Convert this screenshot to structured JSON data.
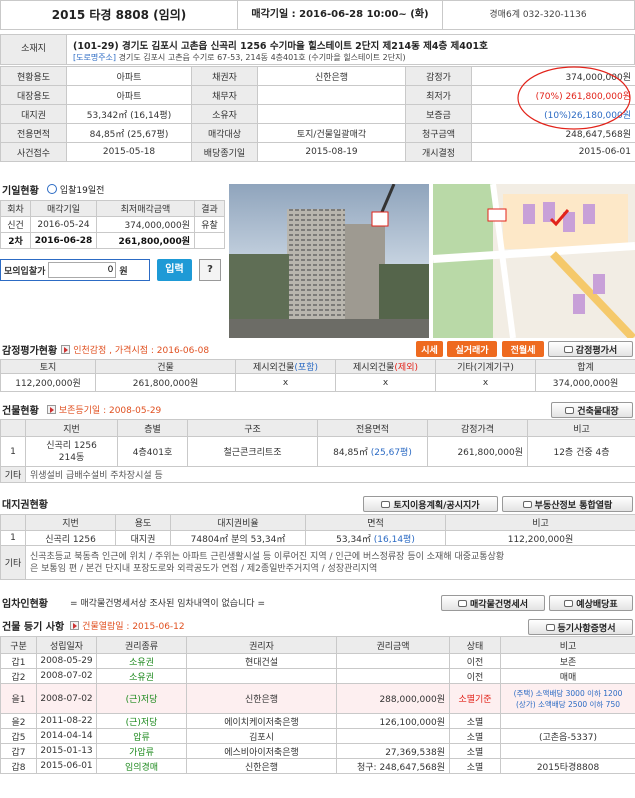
{
  "header": {
    "case_no": "2015 타경 8808 (임의)",
    "sale_date": "매각기일 : 2016-06-28 10:00~ (화)",
    "court": "경매6계 032-320-1136"
  },
  "location": {
    "label": "소재지",
    "address": "(101-29) 경기도 김포시 고촌읍 신곡리 1256 수기마을 힐스테이트 2단지 제214동 제4층 제401호",
    "road_tag": "[도로명주소]",
    "road_address": "경기도 김포시 고촌읍 수기로 67-53, 214동 4층401호 (수기마을 힐스테이트 2단지)"
  },
  "summary": [
    [
      "현황용도",
      "아파트",
      "채권자",
      "신한은행",
      "감정가",
      "374,000,000원"
    ],
    [
      "대장용도",
      "아파트",
      "채무자",
      "",
      "최저가",
      "(70%) 261,800,000원"
    ],
    [
      "대지권",
      "53,342㎡ (16,14평)",
      "소유자",
      "",
      "보증금",
      "(10%)26,180,000원"
    ],
    [
      "전용면적",
      "84,85㎡ (25,67평)",
      "매각대상",
      "토지/건물일괄매각",
      "청구금액",
      "248,647,568원"
    ],
    [
      "사건접수",
      "2015-05-18",
      "배당종기일",
      "2015-08-19",
      "개시결정",
      "2015-06-01"
    ]
  ],
  "bidding": {
    "title": "기일현황",
    "view_label": "입찰19일전",
    "headers": [
      "회차",
      "매각기일",
      "최저매각금액",
      "결과"
    ],
    "rows": [
      [
        "신건",
        "2016-05-24",
        "374,000,000원",
        "유찰"
      ],
      [
        "2차",
        "2016-06-28",
        "261,800,000원",
        ""
      ]
    ],
    "mock_label": "모의입찰가",
    "mock_value": "0",
    "mock_unit": "원",
    "input_btn": "입력",
    "help_btn": "?"
  },
  "appraisal": {
    "title": "감정평가현황",
    "sub": "인천감정 , 가격시점 : 2016-06-08",
    "btn_market": "시세",
    "btn_actual": "실거래가",
    "btn_lease": "전월세",
    "btn_doc": "감정평가서",
    "headers": [
      "토지",
      "건물",
      "제시외건물(포함)",
      "제시외건물(제외)",
      "기타(기계기구)",
      "합계"
    ],
    "row": [
      "112,200,000원",
      "261,800,000원",
      "x",
      "x",
      "x",
      "374,000,000원"
    ]
  },
  "building": {
    "title": "건물현황",
    "sub": "보존등기일 : 2008-05-29",
    "btn": "건축물대장",
    "headers": [
      "",
      "지번",
      "층별",
      "구조",
      "전용면적",
      "감정가격",
      "비고"
    ],
    "row": [
      "1",
      "신곡리 1256\n214동",
      "4층401호",
      "철근콘크리트조",
      "84,85㎡",
      "(25,67평)",
      "261,800,000원",
      "12층 건중 4층"
    ],
    "etc_label": "기타",
    "etc": "위생설비 급배수설비 주차장시설 등"
  },
  "land": {
    "title": "대지권현황",
    "btn1": "토지이용계획/공시지가",
    "btn2": "부동산정보 통합열람",
    "headers": [
      "",
      "지번",
      "용도",
      "대지권비율",
      "면적",
      "비고"
    ],
    "row": [
      "1",
      "신곡리 1256",
      "대지권",
      "74804㎡ 분의 53,34㎡",
      "53,34㎡",
      "(16,14평)",
      "112,200,000원"
    ],
    "etc_label": "기타",
    "etc1": "신곡초등교 북동측 인근에 위치 / 주위는 아파트 근린생활시설 등 이루어진 지역 / 인근에 버스정류장 등이 소재해 대중교통상황",
    "etc2": "은 보통임 편 / 본건 단지내 포장도로와 외곽공도가 연접 / 제2종일반주거지역 / 성장관리지역"
  },
  "tenant": {
    "title": "임차인현황",
    "notice": "= 매각물건명세서상 조사된 임차내역이 없습니다 =",
    "btn1": "매각물건명세서",
    "btn2": "예상배당표"
  },
  "registry": {
    "title": "건물 등기 사항",
    "sub": "건물열람일 : 2015-06-12",
    "btn": "등기사항증명서",
    "headers": [
      "구분",
      "성립일자",
      "권리종류",
      "권리자",
      "권리금액",
      "상태",
      "비고"
    ],
    "rows": [
      [
        "갑1",
        "2008-05-29",
        "소유권",
        "현대건설",
        "",
        "이전",
        "보존"
      ],
      [
        "갑2",
        "2008-07-02",
        "소유권",
        "",
        "",
        "이전",
        "매매"
      ],
      [
        "을1",
        "2008-07-02",
        "(근)저당",
        "신한은행",
        "288,000,000원",
        "소멸기준",
        "(주택) 소액배당 3000 이하 1200|(상가) 소액배당 2500 이하 750"
      ],
      [
        "을2",
        "2011-08-22",
        "(근)저당",
        "에이치케이저축은행",
        "126,100,000원",
        "소멸",
        ""
      ],
      [
        "갑5",
        "2014-04-14",
        "압류",
        "김포시",
        "",
        "소멸",
        "(고촌읍-5337)"
      ],
      [
        "갑7",
        "2015-01-13",
        "가압류",
        "에스비아이저축은행",
        "27,369,538원",
        "소멸",
        ""
      ],
      [
        "갑8",
        "2015-06-01",
        "임의경매",
        "신한은행",
        "청구: 248,647,568원",
        "소멸",
        "2015타경8808"
      ]
    ]
  },
  "colors": {
    "accent": "#ee6a1f",
    "red": "#e2231a",
    "blue": "#2c6bc4",
    "green": "#1e8a1e"
  }
}
